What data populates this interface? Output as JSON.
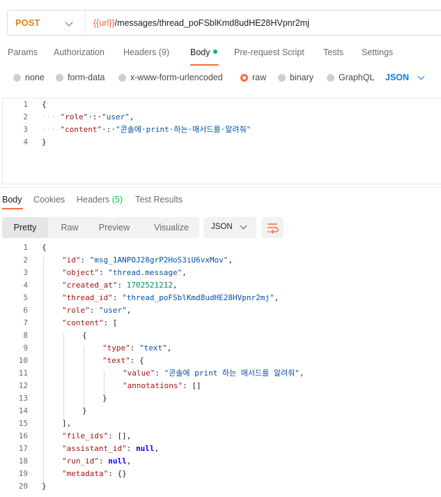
{
  "request": {
    "method": "POST",
    "url_var": "{{url}}",
    "url_path": "/messages/thread_poFSblKmd8udHE28HVpnr2mj"
  },
  "request_tabs": [
    "Params",
    "Authorization",
    "Headers (9)",
    "Body",
    "Pre-request Script",
    "Tests",
    "Settings"
  ],
  "body_types": [
    "none",
    "form-data",
    "x-www-form-urlencoded",
    "raw",
    "binary",
    "GraphQL"
  ],
  "raw_format": "JSON",
  "request_body": {
    "lines": [
      [
        {
          "t": "p",
          "v": "{"
        }
      ],
      [
        {
          "t": "g",
          "v": "····"
        },
        {
          "t": "k",
          "v": "\"role\""
        },
        {
          "t": "p",
          "v": "·:·"
        },
        {
          "t": "s",
          "v": "\"user\""
        },
        {
          "t": "p",
          "v": ","
        }
      ],
      [
        {
          "t": "g",
          "v": "····"
        },
        {
          "t": "k",
          "v": "\"content\""
        },
        {
          "t": "p",
          "v": "·:·"
        },
        {
          "t": "s",
          "v": "\"콘솔에·print·하는·매서드를·알려줘\""
        }
      ],
      [
        {
          "t": "p",
          "v": "}"
        }
      ]
    ]
  },
  "response_tabs": [
    "Body",
    "Cookies",
    "Headers (5)",
    "Test Results"
  ],
  "response_headers_count": "(5)",
  "view_modes": [
    "Pretty",
    "Raw",
    "Preview",
    "Visualize"
  ],
  "response_format": "JSON",
  "response_body": {
    "lines": [
      [
        {
          "t": "p",
          "v": "{"
        }
      ],
      [
        {
          "t": "k",
          "v": "\"id\""
        },
        {
          "t": "p",
          "v": ": "
        },
        {
          "t": "s",
          "v": "\"msg_1ANPOJ28grP2HoS3iU6vxMov\""
        },
        {
          "t": "p",
          "v": ","
        }
      ],
      [
        {
          "t": "k",
          "v": "\"object\""
        },
        {
          "t": "p",
          "v": ": "
        },
        {
          "t": "s",
          "v": "\"thread.message\""
        },
        {
          "t": "p",
          "v": ","
        }
      ],
      [
        {
          "t": "k",
          "v": "\"created_at\""
        },
        {
          "t": "p",
          "v": ": "
        },
        {
          "t": "n",
          "v": "1702521212"
        },
        {
          "t": "p",
          "v": ","
        }
      ],
      [
        {
          "t": "k",
          "v": "\"thread_id\""
        },
        {
          "t": "p",
          "v": ": "
        },
        {
          "t": "s",
          "v": "\"thread_poFSblKmd8udHE28HVpnr2mj\""
        },
        {
          "t": "p",
          "v": ","
        }
      ],
      [
        {
          "t": "k",
          "v": "\"role\""
        },
        {
          "t": "p",
          "v": ": "
        },
        {
          "t": "s",
          "v": "\"user\""
        },
        {
          "t": "p",
          "v": ","
        }
      ],
      [
        {
          "t": "k",
          "v": "\"content\""
        },
        {
          "t": "p",
          "v": ": ["
        }
      ],
      [
        {
          "t": "p",
          "v": "{"
        }
      ],
      [
        {
          "t": "k",
          "v": "\"type\""
        },
        {
          "t": "p",
          "v": ": "
        },
        {
          "t": "s",
          "v": "\"text\""
        },
        {
          "t": "p",
          "v": ","
        }
      ],
      [
        {
          "t": "k",
          "v": "\"text\""
        },
        {
          "t": "p",
          "v": ": {"
        }
      ],
      [
        {
          "t": "k",
          "v": "\"value\""
        },
        {
          "t": "p",
          "v": ": "
        },
        {
          "t": "s",
          "v": "\"콘솔에 print 하는 매서드를 알려줘\""
        },
        {
          "t": "p",
          "v": ","
        }
      ],
      [
        {
          "t": "k",
          "v": "\"annotations\""
        },
        {
          "t": "p",
          "v": ": []"
        }
      ],
      [
        {
          "t": "p",
          "v": "}"
        }
      ],
      [
        {
          "t": "p",
          "v": "}"
        }
      ],
      [
        {
          "t": "p",
          "v": "],"
        }
      ],
      [
        {
          "t": "k",
          "v": "\"file_ids\""
        },
        {
          "t": "p",
          "v": ": [],"
        }
      ],
      [
        {
          "t": "k",
          "v": "\"assistant_id\""
        },
        {
          "t": "p",
          "v": ": "
        },
        {
          "t": "kw",
          "v": "null"
        },
        {
          "t": "p",
          "v": ","
        }
      ],
      [
        {
          "t": "k",
          "v": "\"run_id\""
        },
        {
          "t": "p",
          "v": ": "
        },
        {
          "t": "kw",
          "v": "null"
        },
        {
          "t": "p",
          "v": ","
        }
      ],
      [
        {
          "t": "k",
          "v": "\"metadata\""
        },
        {
          "t": "p",
          "v": ": {}"
        }
      ],
      [
        {
          "t": "p",
          "v": "}"
        }
      ]
    ]
  }
}
